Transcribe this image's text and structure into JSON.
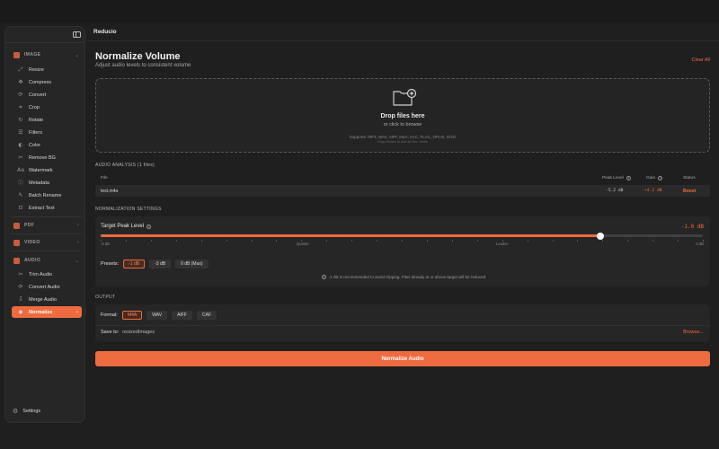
{
  "app": {
    "title": "Reducio"
  },
  "colors": {
    "accent": "#ee6b3f",
    "background": "#1f1f1f",
    "panel": "#262626"
  },
  "sidebar": {
    "image": {
      "label": "IMAGE",
      "items": [
        {
          "label": "Resize",
          "icon": "resize-icon"
        },
        {
          "label": "Compress",
          "icon": "compress-icon"
        },
        {
          "label": "Convert",
          "icon": "convert-icon"
        },
        {
          "label": "Crop",
          "icon": "crop-icon"
        },
        {
          "label": "Rotate",
          "icon": "rotate-icon"
        },
        {
          "label": "Filters",
          "icon": "filters-icon"
        },
        {
          "label": "Color",
          "icon": "color-icon"
        },
        {
          "label": "Remove BG",
          "icon": "remove-bg-icon"
        },
        {
          "label": "Watermark",
          "icon": "watermark-icon"
        },
        {
          "label": "Metadata",
          "icon": "metadata-icon"
        },
        {
          "label": "Batch Rename",
          "icon": "batch-rename-icon"
        },
        {
          "label": "Extract Text",
          "icon": "extract-text-icon"
        }
      ]
    },
    "pdf": {
      "label": "PDF"
    },
    "video": {
      "label": "VIDEO"
    },
    "audio": {
      "label": "AUDIO",
      "items": [
        {
          "label": "Trim Audio",
          "icon": "trim-audio-icon"
        },
        {
          "label": "Convert Audio",
          "icon": "convert-audio-icon"
        },
        {
          "label": "Merge Audio",
          "icon": "merge-audio-icon"
        },
        {
          "label": "Normalize",
          "icon": "normalize-icon",
          "active": true
        }
      ]
    },
    "settings": "Settings"
  },
  "page": {
    "title": "Normalize Volume",
    "subtitle": "Adjust audio levels to consistent volume",
    "clear_all": "Clear All"
  },
  "dropzone": {
    "title": "Drop files here",
    "subtitle": "or click to browse",
    "supports": "Supports: MP3, WAV, AIFF, M4A, AAC, FLAC, OPUS, OGG",
    "hint": "Drop folders to add all files inside"
  },
  "analysis": {
    "title": "AUDIO ANALYSIS (1 files)",
    "columns": {
      "file": "File",
      "peak": "Peak Level",
      "gain": "Gain",
      "status": "Status"
    },
    "rows": [
      {
        "file": "test.m4a",
        "peak": "-5.2 dB",
        "gain": "+4.2 dB",
        "status": "Boost"
      }
    ]
  },
  "settings_section": {
    "title": "NORMALIZATION SETTINGS",
    "target_label": "Target Peak Level",
    "target_value": "-1.0 dB",
    "slider_fraction": 0.83,
    "scale": {
      "min": "-6 dB",
      "quieter": "Quieter",
      "louder": "Louder",
      "max": "0 dB"
    },
    "presets_label": "Presets:",
    "presets": [
      "-1 dB",
      "-3 dB",
      "0 dB (Max)"
    ],
    "selected_preset": 0,
    "hint": "-1 dB is recommended to avoid clipping. Files already at or above target will be reduced."
  },
  "output": {
    "title": "OUTPUT",
    "format_label": "Format:",
    "formats": [
      "M4A",
      "WAV",
      "AIFF",
      "CAF"
    ],
    "selected_format": 0,
    "save_label": "Save to:",
    "save_value": "resizedImages",
    "browse": "Browse..."
  },
  "action": {
    "label": "Normalize Audio"
  }
}
